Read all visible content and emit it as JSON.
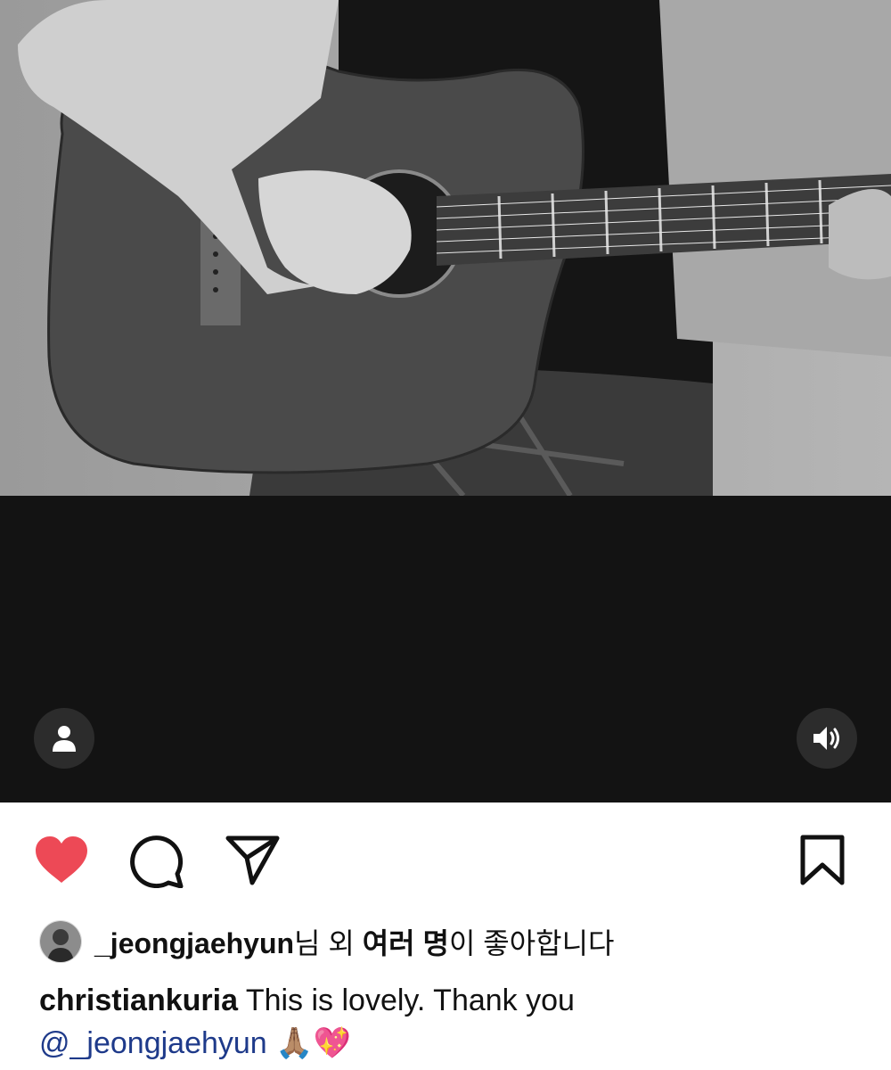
{
  "post": {
    "media": {
      "tag_icon": "person-icon",
      "sound_icon": "speaker-icon",
      "colors": {
        "letterbox": "#131313",
        "overlay_button": "#2c2c2c"
      }
    },
    "actions": {
      "like_icon": "heart-icon",
      "like_color": "#ed4956",
      "comment_icon": "comment-icon",
      "share_icon": "paper-plane-icon",
      "save_icon": "bookmark-icon"
    },
    "likes": {
      "user": "_jeongjaehyun",
      "suffix_1": "님 외 ",
      "others": "여러 명",
      "suffix_2": "이 좋아합니다"
    },
    "caption": {
      "user": "christiankuria",
      "text": " This is lovely. Thank you",
      "mention": "@_jeongjaehyun",
      "emoji": " 🙏🏽💖"
    }
  }
}
